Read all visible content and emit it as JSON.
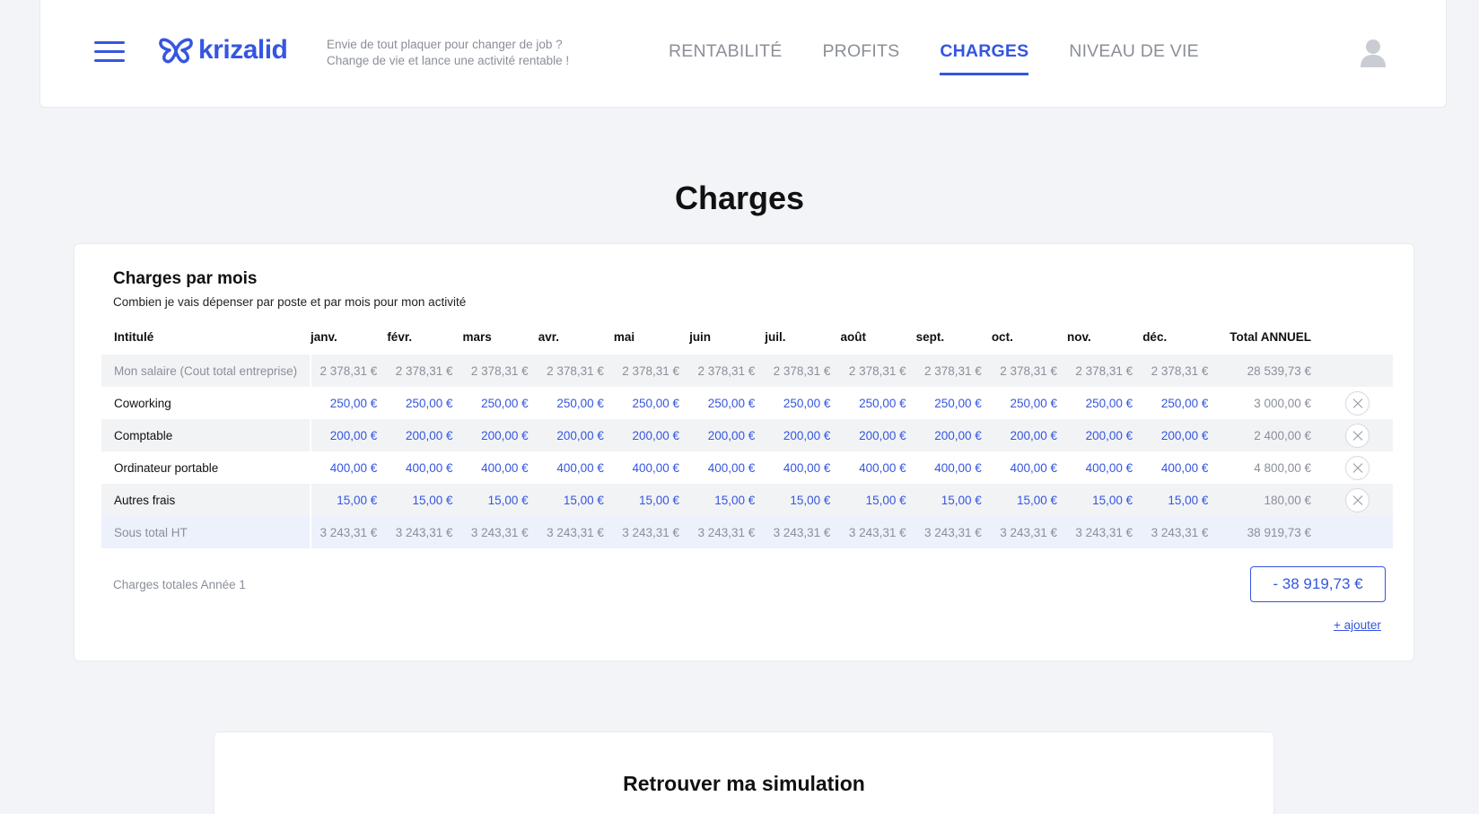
{
  "header": {
    "logo_text": "krizalid",
    "tagline_line1": "Envie de tout plaquer pour changer de job ?",
    "tagline_line2": "Change de vie et lance une activité rentable !",
    "nav": [
      "RENTABILITÉ",
      "PROFITS",
      "CHARGES",
      "NIVEAU DE VIE"
    ],
    "active_nav": "CHARGES",
    "accent_color": "#3556e0"
  },
  "page_title": "Charges",
  "card": {
    "title": "Charges par mois",
    "subtitle": "Combien je vais dépenser par poste et par mois pour mon activité",
    "columns": [
      "Intitulé",
      "janv.",
      "févr.",
      "mars",
      "avr.",
      "mai",
      "juin",
      "juil.",
      "août",
      "sept.",
      "oct.",
      "nov.",
      "déc.",
      "Total ANNUEL"
    ],
    "rows": [
      {
        "label": "Mon salaire (Cout total entreprise)",
        "month": "2 378,31 €",
        "total": "28 539,73 €"
      },
      {
        "label": "Coworking",
        "month": "250,00 €",
        "total": "3 000,00 €"
      },
      {
        "label": "Comptable",
        "month": "200,00 €",
        "total": "2 400,00 €"
      },
      {
        "label": "Ordinateur portable",
        "month": "400,00 €",
        "total": "4 800,00 €"
      },
      {
        "label": "Autres frais",
        "month": "15,00 €",
        "total": "180,00 €"
      },
      {
        "label": "Sous total HT",
        "month": "3 243,31 €",
        "total": "38 919,73 €"
      }
    ],
    "total_label": "Charges totales Année 1",
    "total_value": "- 38 919,73 €",
    "add_link": "+ ajouter"
  },
  "card2": {
    "title": "Retrouver ma simulation"
  },
  "icons": [
    "menu-icon",
    "butterfly-logo-icon",
    "user-icon",
    "close-icon"
  ]
}
